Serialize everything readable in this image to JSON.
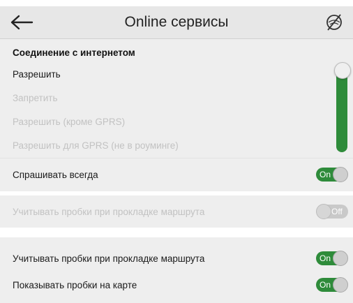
{
  "header": {
    "title": "Online сервисы",
    "back_icon": "arrow-left-icon",
    "right_icon": "offline-slashed-circle-icon"
  },
  "connection": {
    "section_title": "Соединение с интернетом",
    "options": [
      {
        "label": "Разрешить",
        "enabled": true
      },
      {
        "label": "Запретить",
        "enabled": false
      },
      {
        "label": "Разрешить (кроме GPRS)",
        "enabled": false
      },
      {
        "label": "Разрешить для GPRS (не в роуминге)",
        "enabled": false
      }
    ],
    "selected_index": 0,
    "ask_always": {
      "label": "Спрашивать всегда",
      "toggle": "On"
    }
  },
  "traffic_disabled": {
    "label": "Учитывать пробки при прокладке маршрута",
    "toggle": "Off"
  },
  "traffic": {
    "route": {
      "label": "Учитывать пробки при прокладке маршрута",
      "toggle": "On"
    },
    "show_map": {
      "label": "Показывать пробки на карте",
      "toggle": "On"
    }
  },
  "colors": {
    "accent_green": "#2e8b3a",
    "panel_bg": "#eeeeee",
    "header_bg": "#e7e7e7",
    "disabled_text": "#c2c2c2"
  }
}
